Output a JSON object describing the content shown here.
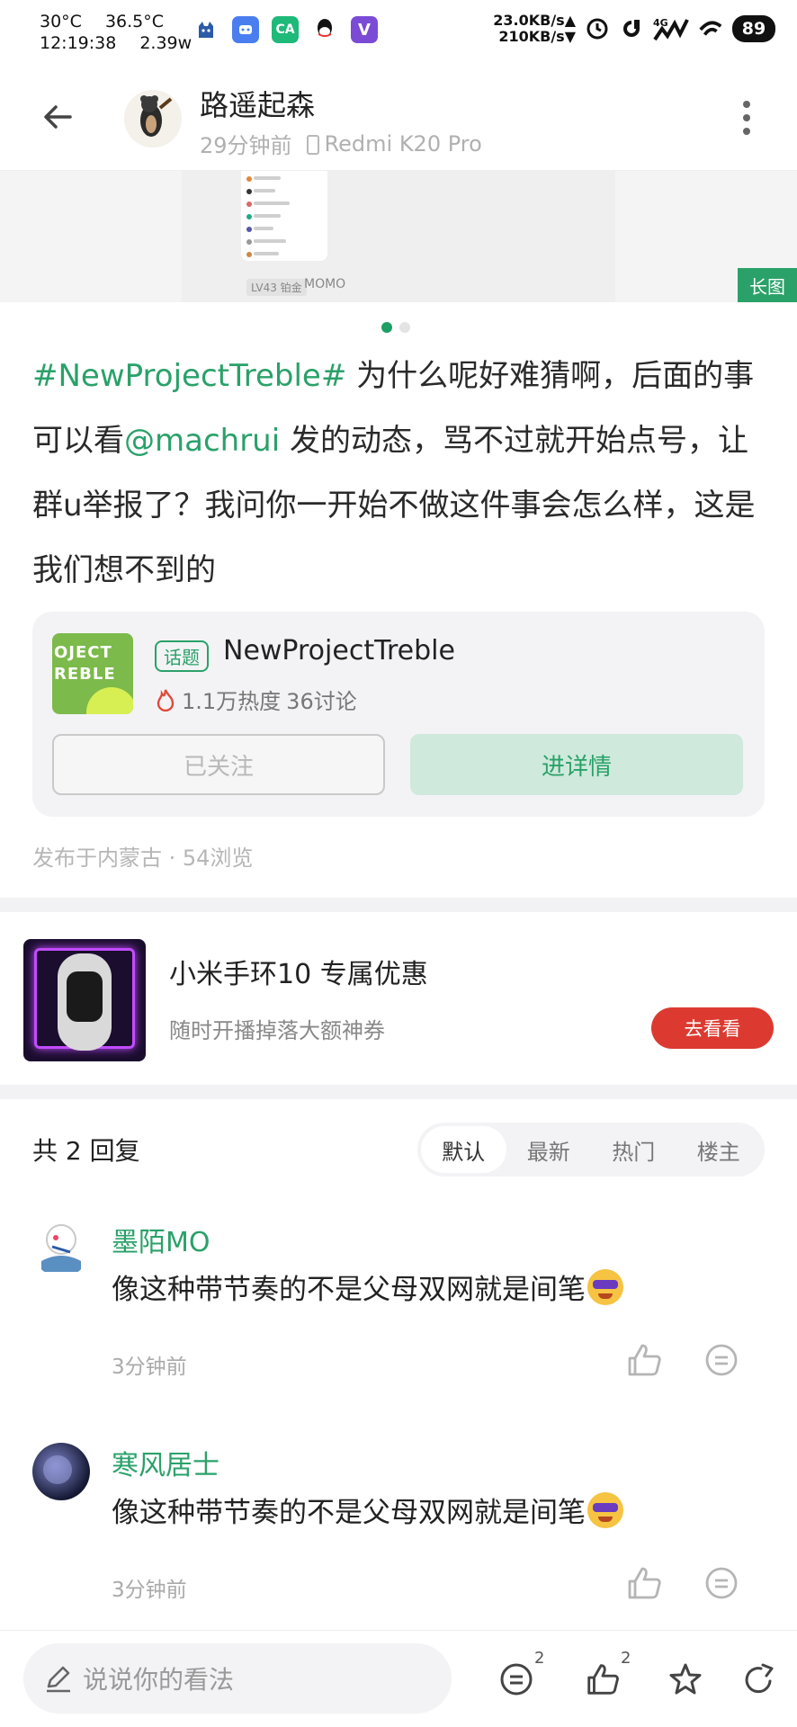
{
  "status_bar": {
    "temp_battery": "30°C",
    "temp_ambient": "36.5°C",
    "time": "12:19:38",
    "power": "2.39w",
    "upload_speed": "23.0KB/s▲",
    "download_speed": "210KB/s▼",
    "network": "4G",
    "battery": "89"
  },
  "header": {
    "username": "路遥起森",
    "posted_ago": "29分钟前",
    "device": "Redmi K20 Pro"
  },
  "image_strip": {
    "level": "LV43 铂金",
    "nickname": "MOMO",
    "long_image_label": "长图"
  },
  "post": {
    "hashtag": "#NewProjectTreble#",
    "text_part1": " 为什么呢好难猜啊，后面的事可以看",
    "mention": "@machrui",
    "text_part2": " 发的动态，骂不过就开始点号，让群u举报了？我问你一开始不做这件事会怎么样，这是我们想不到的"
  },
  "topic": {
    "thumb_text": "OJECT\nREBLE",
    "badge": "话题",
    "title": "NewProjectTreble",
    "heat": "1.1万热度",
    "discussions": "36讨论",
    "followed_label": "已关注",
    "detail_label": "进详情"
  },
  "publish_info": "发布于内蒙古 · 54浏览",
  "ad": {
    "title": "小米手环10 专属优惠",
    "subtitle": "随时开播掉落大额神券",
    "button": "去看看"
  },
  "replies": {
    "count_label": "共 2 回复",
    "sort_options": [
      "默认",
      "最新",
      "热门",
      "楼主"
    ],
    "items": [
      {
        "name": "墨陌MO",
        "text": "像这种带节奏的不是父母双网就是间笔",
        "time": "3分钟前"
      },
      {
        "name": "寒风居士",
        "text": "像这种带节奏的不是父母双网就是间笔",
        "time": "3分钟前"
      }
    ]
  },
  "bottom_bar": {
    "input_placeholder": "说说你的看法",
    "comment_count": "2",
    "like_count": "2"
  },
  "colors": {
    "accent": "#2aa169",
    "ad_button": "#dc3a30"
  }
}
